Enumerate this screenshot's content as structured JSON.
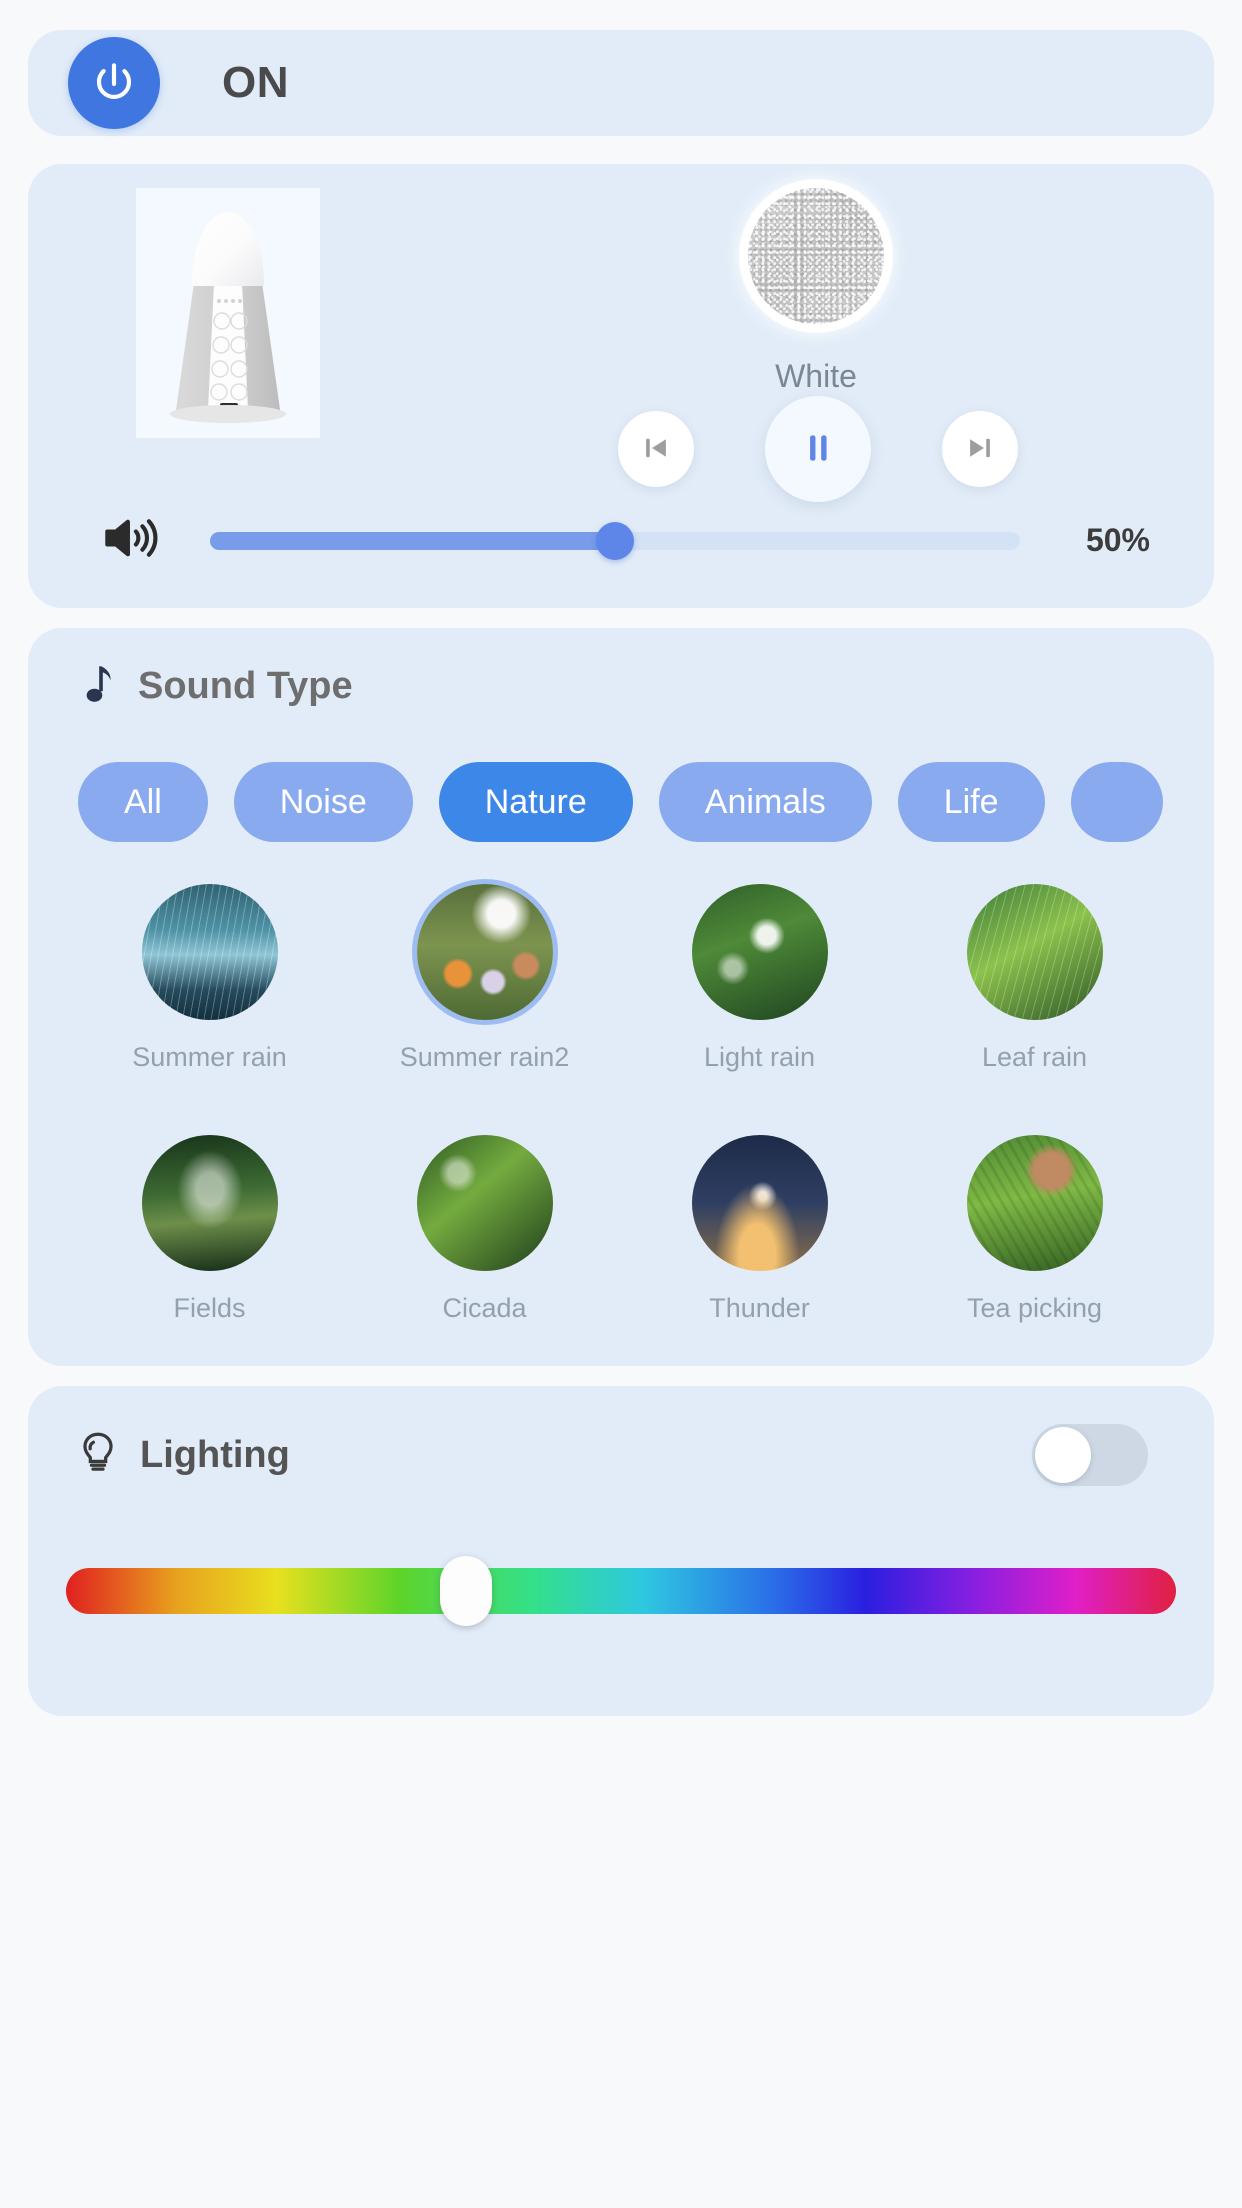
{
  "power": {
    "icon": "power-icon",
    "label": "ON",
    "active": true,
    "accent_color": "#3f76e0"
  },
  "player": {
    "device_image_alt": "white-noise-machine",
    "current_sound": {
      "name": "White",
      "category": "Noise"
    },
    "transport": {
      "previous_label": "Previous",
      "play_pause_label": "Pause",
      "next_label": "Next",
      "state": "playing"
    },
    "volume": {
      "icon": "volume-icon",
      "value": 50,
      "display": "50%",
      "min": 0,
      "max": 100,
      "fill_color": "#789cea",
      "track_color": "#d3e2f5"
    }
  },
  "sound_type": {
    "icon": "music-note-icon",
    "title": "Sound Type",
    "filters": [
      {
        "label": "All",
        "selected": false
      },
      {
        "label": "Noise",
        "selected": false
      },
      {
        "label": "Nature",
        "selected": true
      },
      {
        "label": "Animals",
        "selected": false
      },
      {
        "label": "Life",
        "selected": false
      },
      {
        "label": "",
        "selected": false
      }
    ],
    "selected_filter": "Nature",
    "chip_color": "#8aaaf0",
    "chip_selected_color": "#3d87e8",
    "sounds": [
      {
        "label": "Summer rain",
        "art": "art-summer-rain",
        "active": false
      },
      {
        "label": "Summer rain2",
        "art": "art-summer-rain2",
        "active": true
      },
      {
        "label": "Light rain",
        "art": "art-light-rain",
        "active": false
      },
      {
        "label": "Leaf rain",
        "art": "art-leaf-rain",
        "active": false
      },
      {
        "label": "Fields",
        "art": "art-fields",
        "active": false
      },
      {
        "label": "Cicada",
        "art": "art-cicada",
        "active": false
      },
      {
        "label": "Thunder",
        "art": "art-thunder",
        "active": false
      },
      {
        "label": "Tea picking",
        "art": "art-tea-picking",
        "active": false
      }
    ]
  },
  "lighting": {
    "icon": "lightbulb-icon",
    "title": "Lighting",
    "enabled": false,
    "hue_position_pct": 36
  },
  "theme": {
    "page_background": "#f8f9fa",
    "card_background": "#e2ecf8",
    "primary_blue": "#3f76e0",
    "label_gray": "#94a0ad"
  }
}
